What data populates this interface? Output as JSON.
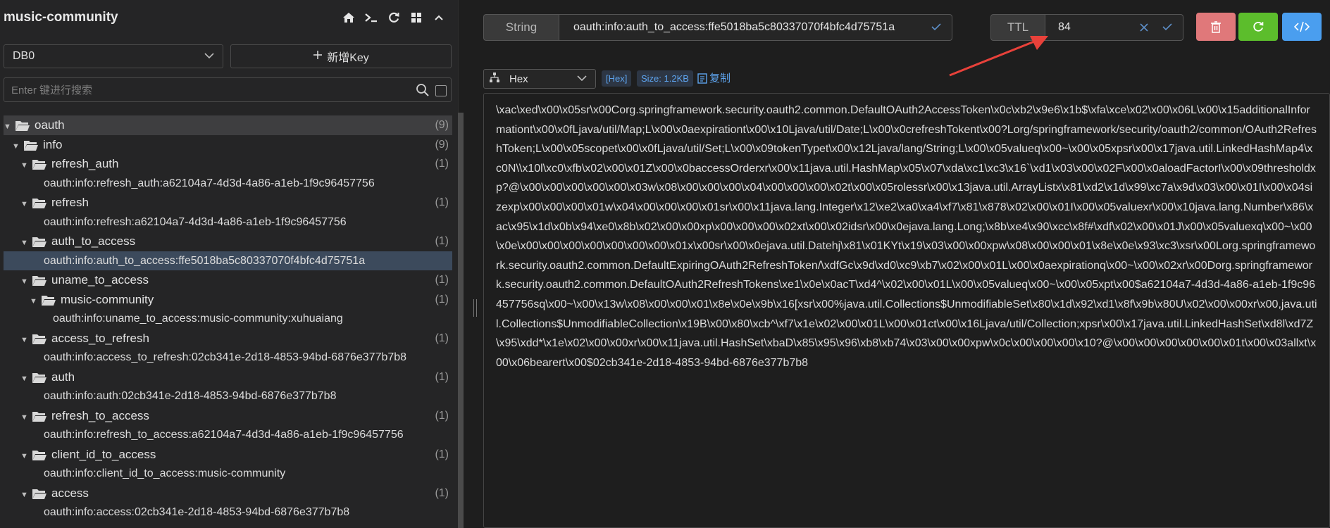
{
  "connection": {
    "name": "music-community",
    "icons": [
      "home-icon",
      "terminal-icon",
      "refresh-icon",
      "grid-icon",
      "chevron-up-icon"
    ]
  },
  "db_select": {
    "value": "DB0"
  },
  "add_key_label": "新增Key",
  "search": {
    "placeholder": "Enter 键进行搜索"
  },
  "tree": {
    "root": {
      "label": "oauth",
      "count": "(9)"
    },
    "info": {
      "label": "info",
      "count": "(9)"
    },
    "refresh_auth": {
      "label": "refresh_auth",
      "count": "(1)",
      "key": "oauth:info:refresh_auth:a62104a7-4d3d-4a86-a1eb-1f9c96457756"
    },
    "refresh": {
      "label": "refresh",
      "count": "(1)",
      "key": "oauth:info:refresh:a62104a7-4d3d-4a86-a1eb-1f9c96457756"
    },
    "auth_to_access": {
      "label": "auth_to_access",
      "count": "(1)",
      "key": "oauth:info:auth_to_access:ffe5018ba5c80337070f4bfc4d75751a"
    },
    "uname_to_access": {
      "label": "uname_to_access",
      "count": "(1)"
    },
    "music_community": {
      "label": "music-community",
      "count": "(1)",
      "key": "oauth:info:uname_to_access:music-community:xuhuaiang"
    },
    "access_to_refresh": {
      "label": "access_to_refresh",
      "count": "(1)",
      "key": "oauth:info:access_to_refresh:02cb341e-2d18-4853-94bd-6876e377b7b8"
    },
    "auth": {
      "label": "auth",
      "count": "(1)",
      "key": "oauth:info:auth:02cb341e-2d18-4853-94bd-6876e377b7b8"
    },
    "refresh_to_access": {
      "label": "refresh_to_access",
      "count": "(1)",
      "key": "oauth:info:refresh_to_access:a62104a7-4d3d-4a86-a1eb-1f9c96457756"
    },
    "client_id_to_access": {
      "label": "client_id_to_access",
      "count": "(1)",
      "key": "oauth:info:client_id_to_access:music-community"
    },
    "access": {
      "label": "access",
      "count": "(1)",
      "key": "oauth:info:access:02cb341e-2d18-4853-94bd-6876e377b7b8"
    }
  },
  "key_header": {
    "type": "String",
    "key_name": "oauth:info:auth_to_access:ffe5018ba5c80337070f4bfc4d75751a",
    "ttl_label": "TTL",
    "ttl_value": "84"
  },
  "action_buttons": [
    "delete-icon",
    "refresh-icon",
    "code-icon"
  ],
  "colors": {
    "delete": "#e0787a",
    "refresh": "#5cbd2c",
    "code": "#4a9eef",
    "accent": "#5ea4ee",
    "arrow": "#e8413a"
  },
  "viewer": {
    "format": "Hex",
    "format_tag": "[Hex]",
    "size_tag": "Size: 1.2KB",
    "copy_label": "复制",
    "value": "\\xac\\xed\\x00\\x05sr\\x00Corg.springframework.security.oauth2.common.DefaultOAuth2AccessToken\\x0c\\xb2\\x9e6\\x1b$\\xfa\\xce\\x02\\x00\\x06L\\x00\\x15additionalInformationt\\x00\\x0fLjava/util/Map;L\\x00\\x0aexpirationt\\x00\\x10Ljava/util/Date;L\\x00\\x0crefreshTokent\\x00?Lorg/springframework/security/oauth2/common/OAuth2RefreshToken;L\\x00\\x05scopet\\x00\\x0fLjava/util/Set;L\\x00\\x09tokenTypet\\x00\\x12Ljava/lang/String;L\\x00\\x05valueq\\x00~\\x00\\x05xpsr\\x00\\x17java.util.LinkedHashMap4\\xc0N\\\\x10l\\xc0\\xfb\\x02\\x00\\x01Z\\x00\\x0baccessOrderxr\\x00\\x11java.util.HashMap\\x05\\x07\\xda\\xc1\\xc3\\x16`\\xd1\\x03\\x00\\x02F\\x00\\x0aloadFactorI\\x00\\x09thresholdxp?@\\x00\\x00\\x00\\x00\\x00\\x03w\\x08\\x00\\x00\\x00\\x04\\x00\\x00\\x00\\x02t\\x00\\x05rolessr\\x00\\x13java.util.ArrayListx\\x81\\xd2\\x1d\\x99\\xc7a\\x9d\\x03\\x00\\x01I\\x00\\x04sizexp\\x00\\x00\\x00\\x01w\\x04\\x00\\x00\\x00\\x01sr\\x00\\x11java.lang.Integer\\x12\\xe2\\xa0\\xa4\\xf7\\x81\\x878\\x02\\x00\\x01I\\x00\\x05valuexr\\x00\\x10java.lang.Number\\x86\\xac\\x95\\x1d\\x0b\\x94\\xe0\\x8b\\x02\\x00\\x00xp\\x00\\x00\\x00\\x02xt\\x00\\x02idsr\\x00\\x0ejava.lang.Long;\\x8b\\xe4\\x90\\xcc\\x8f#\\xdf\\x02\\x00\\x01J\\x00\\x05valuexq\\x00~\\x00\\x0e\\x00\\x00\\x00\\x00\\x00\\x00\\x00\\x01x\\x00sr\\x00\\x0ejava.util.Datehj\\x81\\x01KYt\\x19\\x03\\x00\\x00xpw\\x08\\x00\\x00\\x01\\x8e\\x0e\\x93\\xc3\\xsr\\x00Lorg.springframework.security.oauth2.common.DefaultExpiringOAuth2RefreshToken/\\xdfGc\\x9d\\xd0\\xc9\\xb7\\x02\\x00\\x01L\\x00\\x0aexpirationq\\x00~\\x00\\x02xr\\x00Dorg.springframework.security.oauth2.common.DefaultOAuth2RefreshTokens\\xe1\\x0e\\x0acT\\xd4^\\x02\\x00\\x01L\\x00\\x05valueq\\x00~\\x00\\x05xpt\\x00$a62104a7-4d3d-4a86-a1eb-1f9c96457756sq\\x00~\\x00\\x13w\\x08\\x00\\x00\\x01\\x8e\\x0e\\x9b\\x16[xsr\\x00%java.util.Collections$UnmodifiableSet\\x80\\x1d\\x92\\xd1\\x8f\\x9b\\x80U\\x02\\x00\\x00xr\\x00,java.util.Collections$UnmodifiableCollection\\x19B\\x00\\x80\\xcb^\\xf7\\x1e\\x02\\x00\\x01L\\x00\\x01ct\\x00\\x16Ljava/util/Collection;xpsr\\x00\\x17java.util.LinkedHashSet\\xd8l\\xd7Z\\x95\\xdd*\\x1e\\x02\\x00\\x00xr\\x00\\x11java.util.HashSet\\xbaD\\x85\\x95\\x96\\xb8\\xb74\\x03\\x00\\x00xpw\\x0c\\x00\\x00\\x00\\x10?@\\x00\\x00\\x00\\x00\\x00\\x01t\\x00\\x03allxt\\x00\\x06bearert\\x00$02cb341e-2d18-4853-94bd-6876e377b7b8"
  }
}
